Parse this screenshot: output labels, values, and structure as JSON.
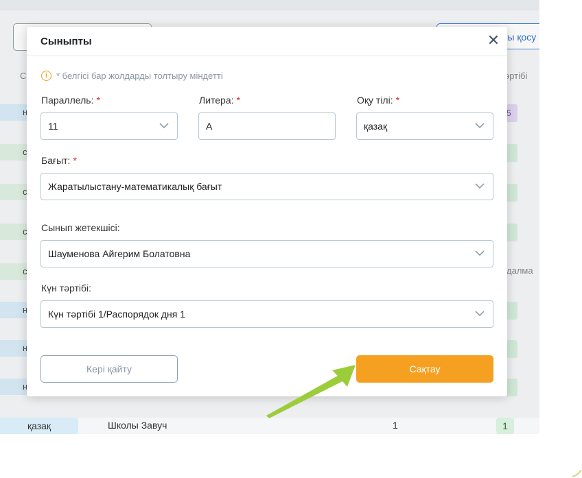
{
  "background": {
    "left_header": "С",
    "right_header": "әртібі",
    "add_button_text": "ты қосу",
    "chips": [
      "н",
      "с",
      "с",
      "с",
      "с",
      "н",
      "н",
      "н"
    ],
    "purple_badge": "5",
    "right_text": "далма",
    "bottom_row": {
      "language": "қазақ",
      "name": "Школы Завуч",
      "count": "1",
      "badge": "1"
    }
  },
  "modal": {
    "title": "Сыныпты",
    "close_icon": "close-icon",
    "hint": "* белгісі бар жолдарды толтыру міндетті",
    "parallel": {
      "label": "Параллель:",
      "value": "11"
    },
    "litera": {
      "label": "Литера:",
      "value": "А"
    },
    "language": {
      "label": "Оқу тілі:",
      "value": "қазақ"
    },
    "direction": {
      "label": "Бағыт:",
      "value": "Жаратылыстану-математикалық бағыт"
    },
    "teacher": {
      "label": "Сынып жетекшісі:",
      "value": "Шауменова Айгерим Болатовна"
    },
    "schedule": {
      "label": "Күн тәртібі:",
      "value": "Күн тәртібі 1/Распорядок дня 1"
    },
    "required_mark": "*",
    "back_button": "Кері қайту",
    "save_button": "Сақтау"
  },
  "colors": {
    "accent_orange": "#f5a021",
    "required_red": "#e0202a",
    "arrow_green": "#9ccc3a"
  }
}
